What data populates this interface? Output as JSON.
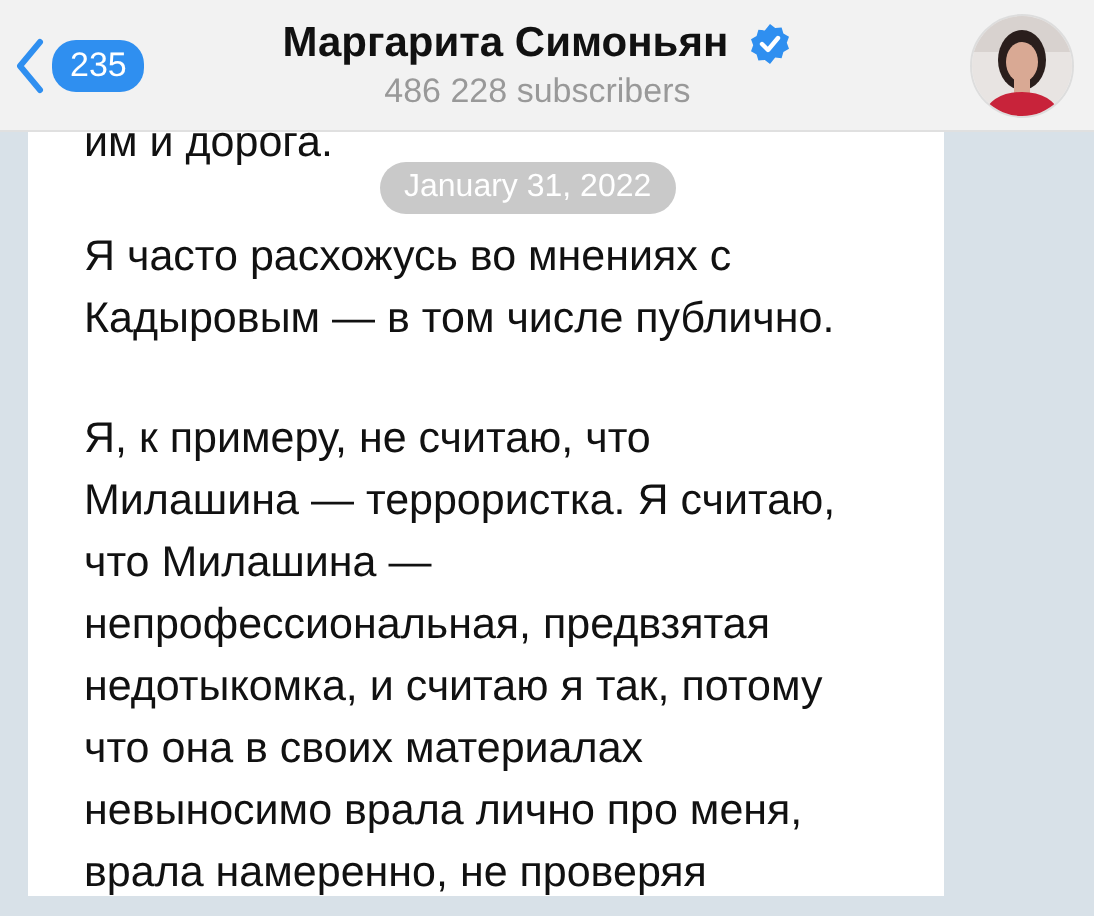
{
  "header": {
    "unread_count": "235",
    "channel_name": "Маргарита Симоньян",
    "verified": true,
    "subscribers": "486 228 subscribers"
  },
  "date_pill": "January 31, 2022",
  "message": {
    "paragraphs": [
      [
        "им и дорога."
      ],
      [
        "Я часто расхожусь во мнениях с",
        "Кадыровым — в том числе публично."
      ],
      [
        "Я, к примеру, не считаю, что",
        "Милашина — террористка. Я считаю,",
        "что Милашина —",
        "непрофессиональная, предвзятая",
        "недотыкомка, и считаю я так, потому",
        "что она в своих материалах",
        "невыносимо врала лично про меня,",
        "врала намеренно, не проверяя"
      ]
    ]
  }
}
